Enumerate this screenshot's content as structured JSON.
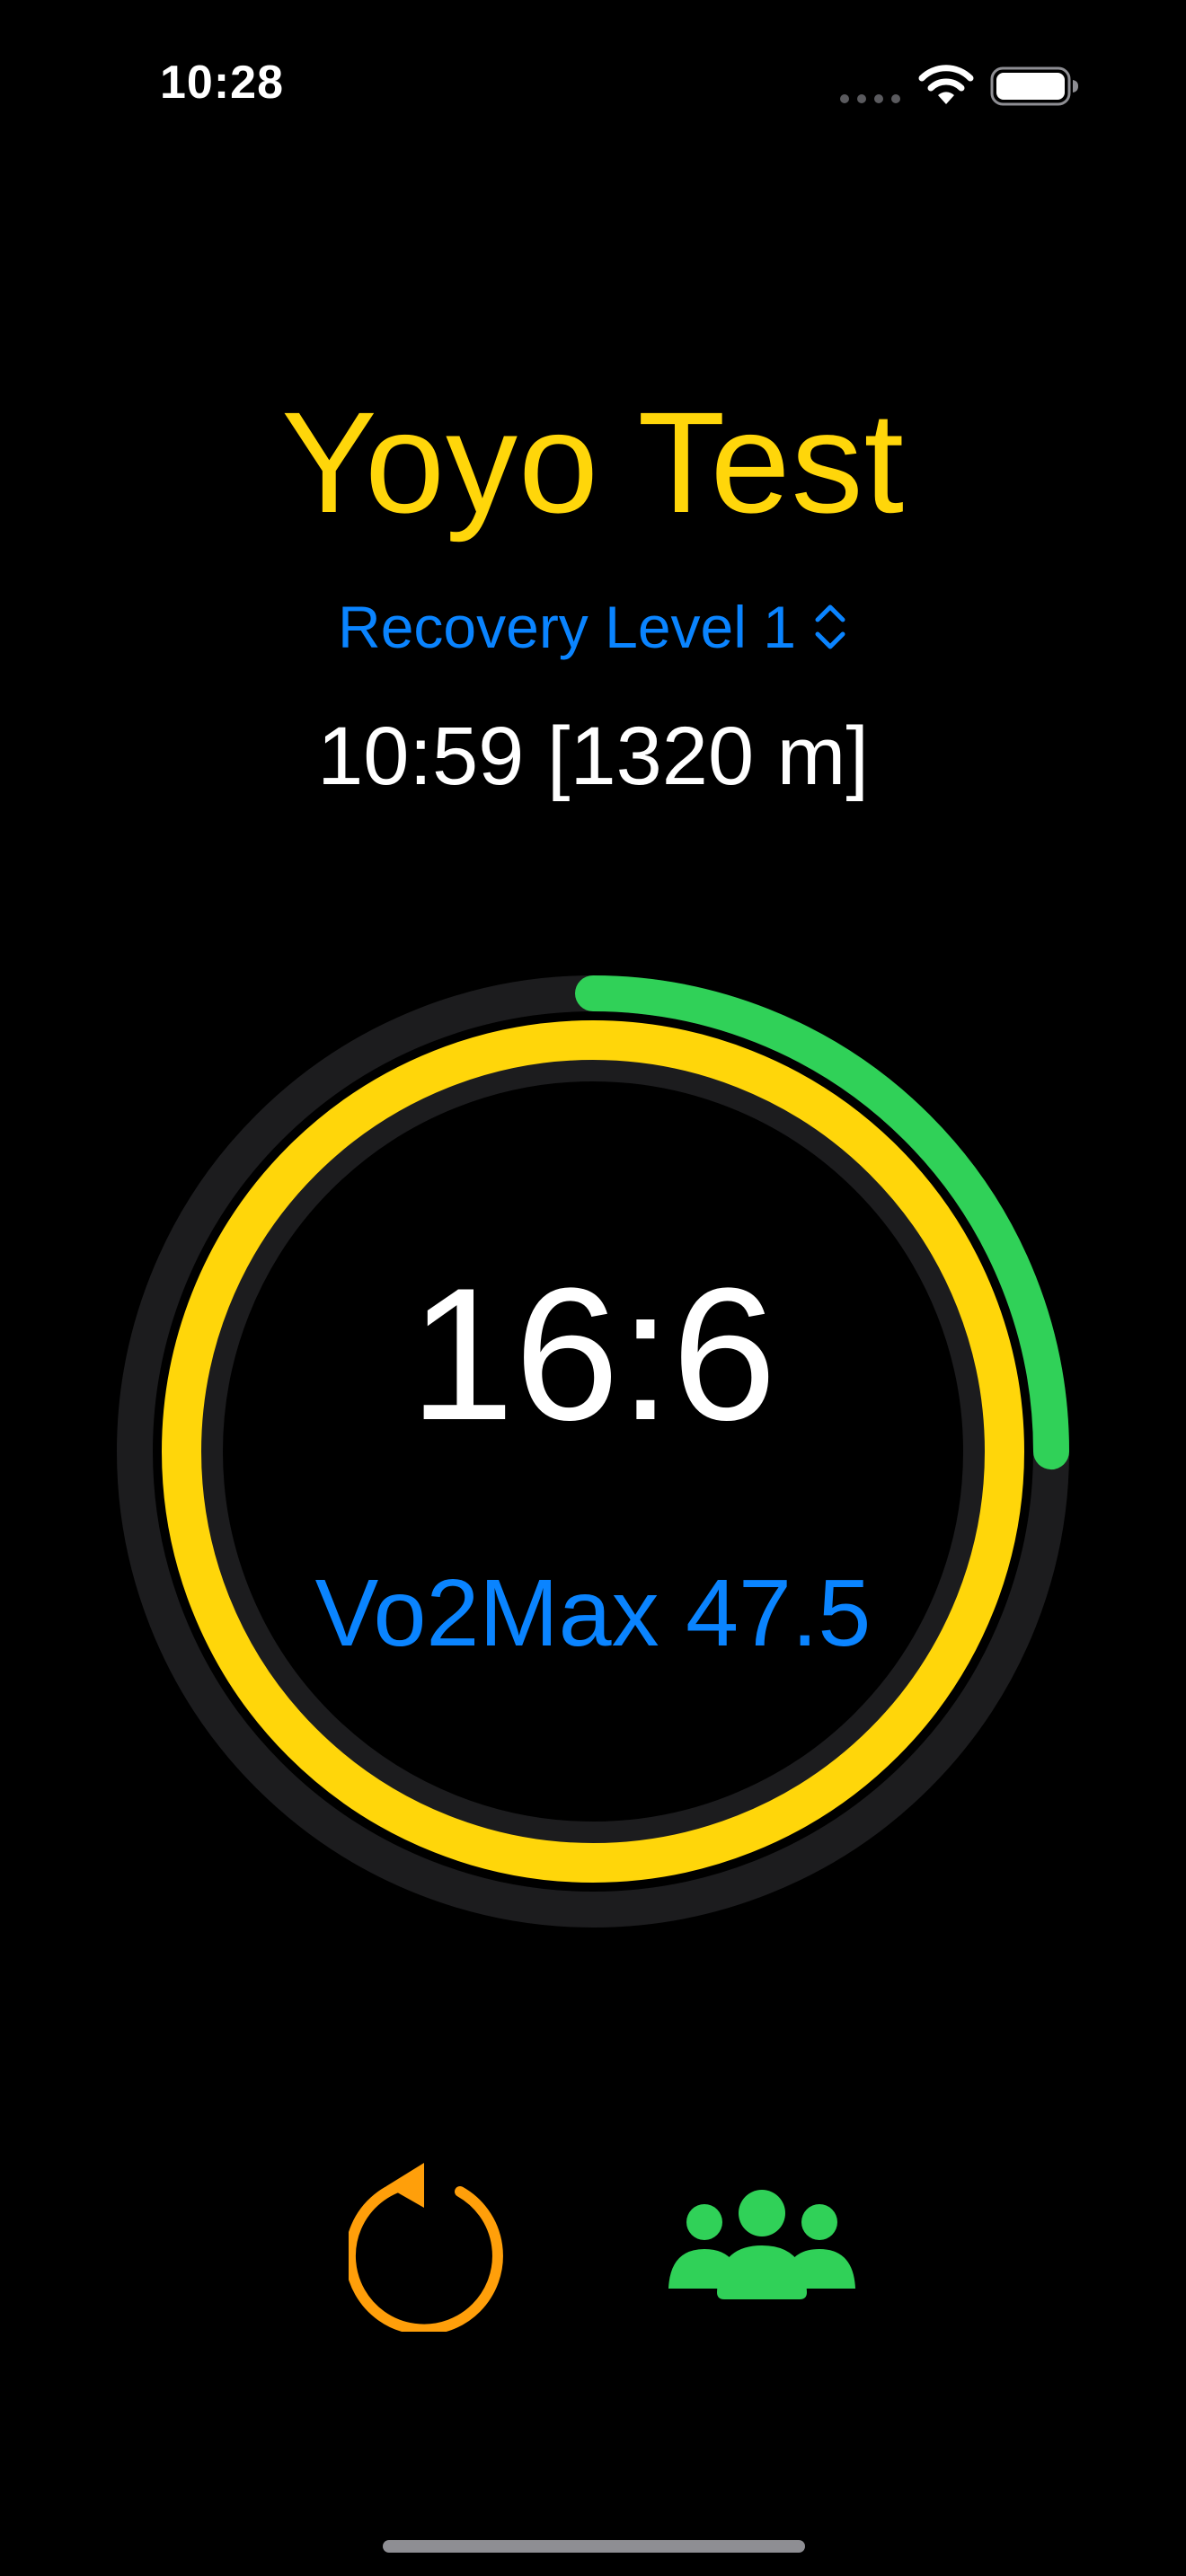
{
  "status_bar": {
    "time": "10:28",
    "wifi_icon": "wifi-icon",
    "battery_icon": "battery-icon"
  },
  "header": {
    "title": "Yoyo Test",
    "level_picker_label": "Recovery Level 1",
    "level_picker_icon": "chevron-up-down-icon",
    "target": "10:59 [1320 m]"
  },
  "ring": {
    "current_level": "16:6",
    "vo2max": "Vo2Max 47.5",
    "outer_progress": 0.25,
    "inner_progress": 1.0,
    "outer_color": "#30D158",
    "inner_color": "#FFD60A",
    "track_color": "#1C1C1E"
  },
  "controls": {
    "reset_icon": "reset-icon",
    "reset_color": "#FF9F0A",
    "team_icon": "team-icon",
    "team_color": "#30D158"
  },
  "colors": {
    "accent_yellow": "#FFD60A",
    "accent_blue": "#0A84FF",
    "background": "#000000"
  }
}
